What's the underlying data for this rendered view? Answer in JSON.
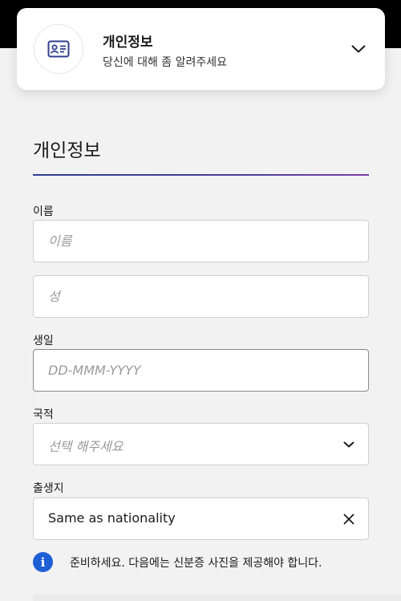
{
  "header": {
    "title": "개인정보",
    "subtitle": "당신에 대해 좀 알려주세요",
    "icon": "id-card-icon",
    "toggle_icon": "chevron-down-icon"
  },
  "section": {
    "title": "개인정보"
  },
  "form": {
    "name_label": "이름",
    "first_name_placeholder": "이름",
    "last_name_placeholder": "성",
    "birthday_label": "생일",
    "birthday_placeholder": "DD-MMM-YYYY",
    "nationality_label": "국적",
    "nationality_placeholder": "선택 해주세요",
    "birthplace_label": "출생지",
    "birthplace_value": "Same as nationality"
  },
  "notice": {
    "icon": "info-icon",
    "icon_glyph": "i",
    "text": "준비하세요. 다음에는 신분증 사진을 제공해야 합니다."
  },
  "colors": {
    "accent": "#1f5fd6",
    "divider_start": "#2f3f8f",
    "divider_end": "#7a3fa0",
    "background": "#f2f2f2"
  }
}
